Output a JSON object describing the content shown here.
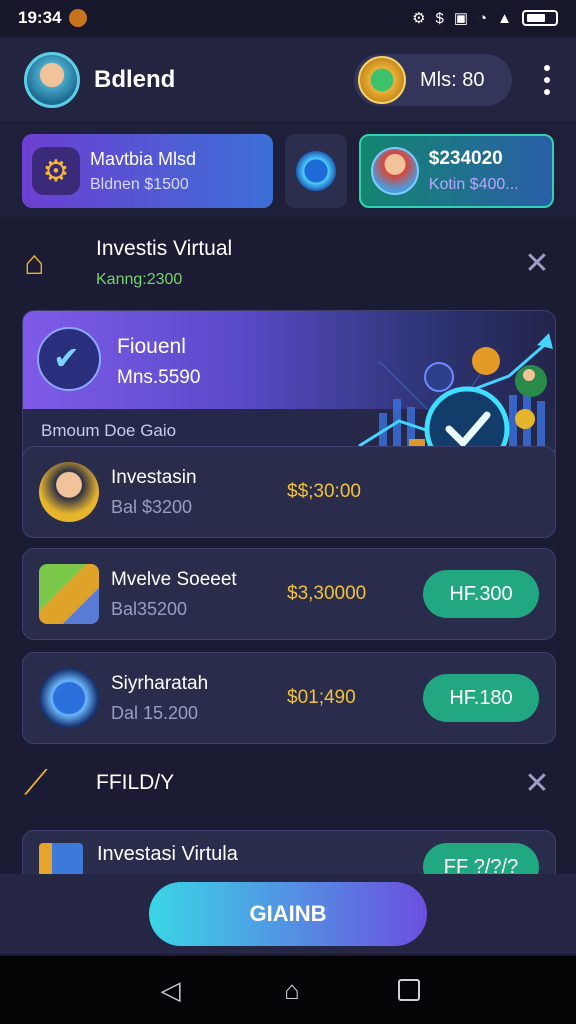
{
  "status_bar": {
    "time": "19:34",
    "icons": [
      "gear-icon",
      "dollar-icon",
      "nfc-icon",
      "wifi-icon",
      "signal-icon",
      "battery-icon"
    ]
  },
  "header": {
    "title": "Bdlend",
    "points": "Mls: 80"
  },
  "summary": {
    "left": {
      "title": "Mavtbia Mlsd",
      "subtitle": "Bldnen $1500"
    },
    "right": {
      "title": "$234020",
      "subtitle": "Kotin $400..."
    }
  },
  "section1": {
    "title": "Investis Virtual",
    "subtitle": "Kanng:2300"
  },
  "feature": {
    "title": "Fiouenl",
    "subtitle": "Mns.5590",
    "caption": "Bmoum Doe Gaio"
  },
  "rows": [
    {
      "title": "Investasin",
      "subtitle": "Bal $3200",
      "amount": "$$;30:00",
      "button": ""
    },
    {
      "title": "Mvelve Soeeet",
      "subtitle": "Bal35200",
      "amount": "$3,30000",
      "button": "HF.300"
    },
    {
      "title": "Siyrharatah",
      "subtitle": "Dal 15.200",
      "amount": "$01;490",
      "button": "HF.180"
    }
  ],
  "section2": {
    "title": "FFILD/Y"
  },
  "bottom_card": {
    "title": "Investasi Virtula",
    "button": "FF ?/?/?"
  },
  "cta": {
    "label": "GIAINB"
  },
  "colors": {
    "accent_green": "#22a880",
    "amount_gold": "#f2c23a",
    "cta_start": "#3ad6e6",
    "cta_end": "#6c4fe0"
  }
}
